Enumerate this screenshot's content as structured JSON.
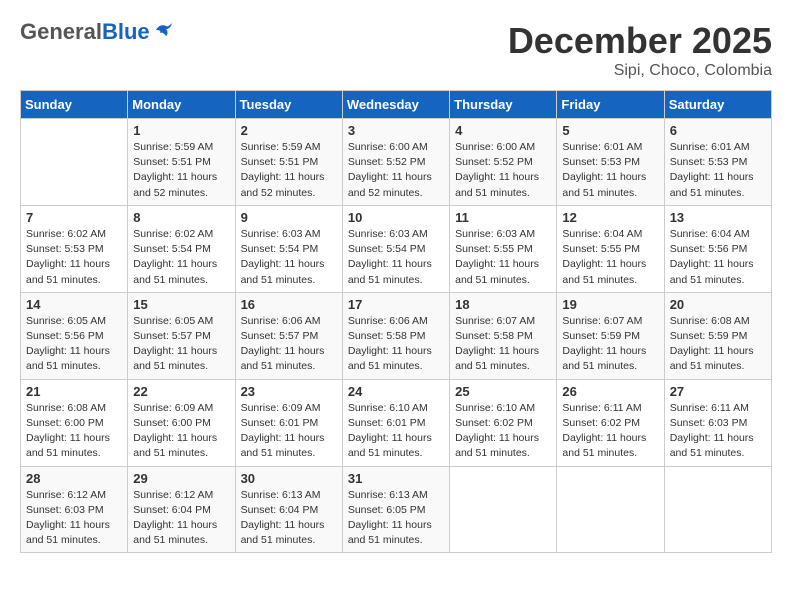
{
  "header": {
    "logo_general": "General",
    "logo_blue": "Blue",
    "month_year": "December 2025",
    "location": "Sipi, Choco, Colombia"
  },
  "days_of_week": [
    "Sunday",
    "Monday",
    "Tuesday",
    "Wednesday",
    "Thursday",
    "Friday",
    "Saturday"
  ],
  "weeks": [
    [
      {
        "day": "",
        "sunrise": "",
        "sunset": "",
        "daylight": ""
      },
      {
        "day": "1",
        "sunrise": "Sunrise: 5:59 AM",
        "sunset": "Sunset: 5:51 PM",
        "daylight": "Daylight: 11 hours and 52 minutes."
      },
      {
        "day": "2",
        "sunrise": "Sunrise: 5:59 AM",
        "sunset": "Sunset: 5:51 PM",
        "daylight": "Daylight: 11 hours and 52 minutes."
      },
      {
        "day": "3",
        "sunrise": "Sunrise: 6:00 AM",
        "sunset": "Sunset: 5:52 PM",
        "daylight": "Daylight: 11 hours and 52 minutes."
      },
      {
        "day": "4",
        "sunrise": "Sunrise: 6:00 AM",
        "sunset": "Sunset: 5:52 PM",
        "daylight": "Daylight: 11 hours and 51 minutes."
      },
      {
        "day": "5",
        "sunrise": "Sunrise: 6:01 AM",
        "sunset": "Sunset: 5:53 PM",
        "daylight": "Daylight: 11 hours and 51 minutes."
      },
      {
        "day": "6",
        "sunrise": "Sunrise: 6:01 AM",
        "sunset": "Sunset: 5:53 PM",
        "daylight": "Daylight: 11 hours and 51 minutes."
      }
    ],
    [
      {
        "day": "7",
        "sunrise": "Sunrise: 6:02 AM",
        "sunset": "Sunset: 5:53 PM",
        "daylight": "Daylight: 11 hours and 51 minutes."
      },
      {
        "day": "8",
        "sunrise": "Sunrise: 6:02 AM",
        "sunset": "Sunset: 5:54 PM",
        "daylight": "Daylight: 11 hours and 51 minutes."
      },
      {
        "day": "9",
        "sunrise": "Sunrise: 6:03 AM",
        "sunset": "Sunset: 5:54 PM",
        "daylight": "Daylight: 11 hours and 51 minutes."
      },
      {
        "day": "10",
        "sunrise": "Sunrise: 6:03 AM",
        "sunset": "Sunset: 5:54 PM",
        "daylight": "Daylight: 11 hours and 51 minutes."
      },
      {
        "day": "11",
        "sunrise": "Sunrise: 6:03 AM",
        "sunset": "Sunset: 5:55 PM",
        "daylight": "Daylight: 11 hours and 51 minutes."
      },
      {
        "day": "12",
        "sunrise": "Sunrise: 6:04 AM",
        "sunset": "Sunset: 5:55 PM",
        "daylight": "Daylight: 11 hours and 51 minutes."
      },
      {
        "day": "13",
        "sunrise": "Sunrise: 6:04 AM",
        "sunset": "Sunset: 5:56 PM",
        "daylight": "Daylight: 11 hours and 51 minutes."
      }
    ],
    [
      {
        "day": "14",
        "sunrise": "Sunrise: 6:05 AM",
        "sunset": "Sunset: 5:56 PM",
        "daylight": "Daylight: 11 hours and 51 minutes."
      },
      {
        "day": "15",
        "sunrise": "Sunrise: 6:05 AM",
        "sunset": "Sunset: 5:57 PM",
        "daylight": "Daylight: 11 hours and 51 minutes."
      },
      {
        "day": "16",
        "sunrise": "Sunrise: 6:06 AM",
        "sunset": "Sunset: 5:57 PM",
        "daylight": "Daylight: 11 hours and 51 minutes."
      },
      {
        "day": "17",
        "sunrise": "Sunrise: 6:06 AM",
        "sunset": "Sunset: 5:58 PM",
        "daylight": "Daylight: 11 hours and 51 minutes."
      },
      {
        "day": "18",
        "sunrise": "Sunrise: 6:07 AM",
        "sunset": "Sunset: 5:58 PM",
        "daylight": "Daylight: 11 hours and 51 minutes."
      },
      {
        "day": "19",
        "sunrise": "Sunrise: 6:07 AM",
        "sunset": "Sunset: 5:59 PM",
        "daylight": "Daylight: 11 hours and 51 minutes."
      },
      {
        "day": "20",
        "sunrise": "Sunrise: 6:08 AM",
        "sunset": "Sunset: 5:59 PM",
        "daylight": "Daylight: 11 hours and 51 minutes."
      }
    ],
    [
      {
        "day": "21",
        "sunrise": "Sunrise: 6:08 AM",
        "sunset": "Sunset: 6:00 PM",
        "daylight": "Daylight: 11 hours and 51 minutes."
      },
      {
        "day": "22",
        "sunrise": "Sunrise: 6:09 AM",
        "sunset": "Sunset: 6:00 PM",
        "daylight": "Daylight: 11 hours and 51 minutes."
      },
      {
        "day": "23",
        "sunrise": "Sunrise: 6:09 AM",
        "sunset": "Sunset: 6:01 PM",
        "daylight": "Daylight: 11 hours and 51 minutes."
      },
      {
        "day": "24",
        "sunrise": "Sunrise: 6:10 AM",
        "sunset": "Sunset: 6:01 PM",
        "daylight": "Daylight: 11 hours and 51 minutes."
      },
      {
        "day": "25",
        "sunrise": "Sunrise: 6:10 AM",
        "sunset": "Sunset: 6:02 PM",
        "daylight": "Daylight: 11 hours and 51 minutes."
      },
      {
        "day": "26",
        "sunrise": "Sunrise: 6:11 AM",
        "sunset": "Sunset: 6:02 PM",
        "daylight": "Daylight: 11 hours and 51 minutes."
      },
      {
        "day": "27",
        "sunrise": "Sunrise: 6:11 AM",
        "sunset": "Sunset: 6:03 PM",
        "daylight": "Daylight: 11 hours and 51 minutes."
      }
    ],
    [
      {
        "day": "28",
        "sunrise": "Sunrise: 6:12 AM",
        "sunset": "Sunset: 6:03 PM",
        "daylight": "Daylight: 11 hours and 51 minutes."
      },
      {
        "day": "29",
        "sunrise": "Sunrise: 6:12 AM",
        "sunset": "Sunset: 6:04 PM",
        "daylight": "Daylight: 11 hours and 51 minutes."
      },
      {
        "day": "30",
        "sunrise": "Sunrise: 6:13 AM",
        "sunset": "Sunset: 6:04 PM",
        "daylight": "Daylight: 11 hours and 51 minutes."
      },
      {
        "day": "31",
        "sunrise": "Sunrise: 6:13 AM",
        "sunset": "Sunset: 6:05 PM",
        "daylight": "Daylight: 11 hours and 51 minutes."
      },
      {
        "day": "",
        "sunrise": "",
        "sunset": "",
        "daylight": ""
      },
      {
        "day": "",
        "sunrise": "",
        "sunset": "",
        "daylight": ""
      },
      {
        "day": "",
        "sunrise": "",
        "sunset": "",
        "daylight": ""
      }
    ]
  ]
}
